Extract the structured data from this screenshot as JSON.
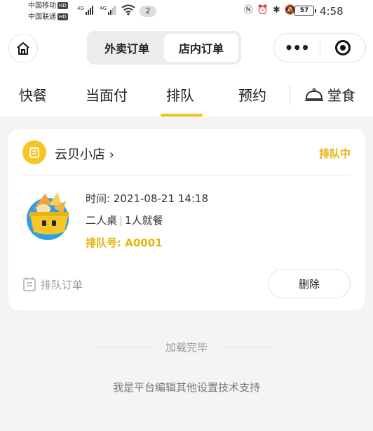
{
  "status_bar": {
    "carrier_1": "中国移动",
    "carrier_2": "中国联通",
    "hd_badge": "HD",
    "network_1": "4G",
    "network_2": "4G",
    "notification_count": "2",
    "battery": "57",
    "time": "4:58"
  },
  "header": {
    "switcher": {
      "options": [
        "外卖订单",
        "店内订单"
      ],
      "selected": "店内订单"
    },
    "more_button": "•••"
  },
  "tabs": {
    "items": [
      "快餐",
      "当面付",
      "排队",
      "预约"
    ],
    "active": "排队",
    "dine_in_label": "堂食"
  },
  "order_card": {
    "shop_name": "云贝小店",
    "shop_chevron": "›",
    "status": "排队中",
    "time_label": "时间:",
    "time_value": "2021-08-21 14:18",
    "table_type": "二人桌",
    "separator": "|",
    "party_size": "1人就餐",
    "queue_label": "排队号:",
    "queue_number": "A0001",
    "order_type_tag": "排队订单",
    "delete_label": "删除"
  },
  "footer": {
    "loaded_text": "加载完毕",
    "support_text": "我是平台编辑其他设置技术支持"
  },
  "colors": {
    "accent": "#f0c419",
    "status_text": "#e9b20c",
    "page_background": "#f4f4f4",
    "icon_blue": "#2f9fe6"
  }
}
